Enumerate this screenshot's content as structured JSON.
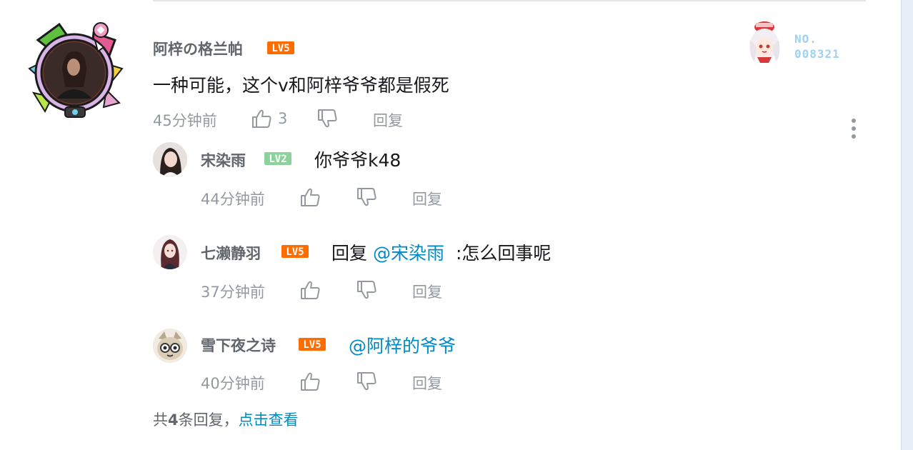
{
  "colors": {
    "link": "#008ac5",
    "meta": "#9499a0",
    "lv5": "#ff6c00",
    "lv2": "#8bd29b",
    "fan_number": "#9dd3ec"
  },
  "comment": {
    "username": "阿梓の格兰帕",
    "level": "LV5",
    "text": "一种可能，这个v和阿梓爷爷都是假死",
    "time": "45分钟前",
    "like_count": "3",
    "reply_label": "回复",
    "fan_card_number": "NO.\n008321",
    "fan_card_line1": "NO.",
    "fan_card_line2": "008321",
    "more_icon": "more-vertical-icon"
  },
  "replies": [
    {
      "username": "宋染雨",
      "level": "LV2",
      "text": "你爷爷k48",
      "time": "44分钟前",
      "reply_label": "回复"
    },
    {
      "username": "七濑静羽",
      "level": "LV5",
      "prefix": "回复",
      "mention": "@宋染雨",
      "text": ":怎么回事呢",
      "time": "37分钟前",
      "reply_label": "回复"
    },
    {
      "username": "雪下夜之诗",
      "level": "LV5",
      "mention": "@阿梓的爷爷",
      "time": "40分钟前",
      "reply_label": "回复"
    }
  ],
  "footer": {
    "prefix": "共",
    "count": "4",
    "suffix": "条回复，",
    "view_link": "点击查看"
  },
  "icons": {
    "like": "thumbs-up-icon",
    "dislike": "thumbs-down-icon"
  }
}
